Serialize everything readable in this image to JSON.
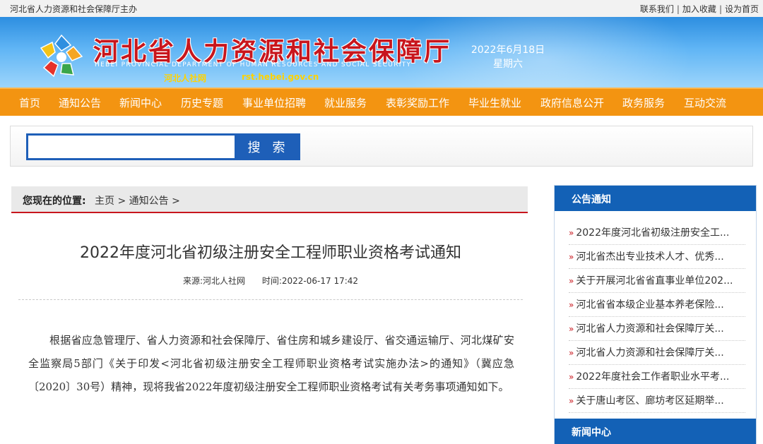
{
  "topbar": {
    "sponsor": "河北省人力资源和社会保障厅主办",
    "links": [
      "联系我们",
      "加入收藏",
      "设为首页"
    ]
  },
  "header": {
    "title_cn": "河北省人力资源和社会保障厅",
    "title_en": "HEBEI PROVINCIAL DEPARTMENT OF HUMAN RESOURCES AND SOCIAL SECURITY",
    "site_short": "河北人社网",
    "site_url": "rst.hebei.gov.cn",
    "date": "2022年6月18日",
    "weekday": "星期六"
  },
  "nav": {
    "items": [
      "首页",
      "通知公告",
      "新闻中心",
      "历史专题",
      "事业单位招聘",
      "就业服务",
      "表彰奖励工作",
      "毕业生就业",
      "政府信息公开",
      "政务服务",
      "互动交流"
    ]
  },
  "search": {
    "value": "",
    "button_label": "搜 索"
  },
  "breadcrumb": {
    "label": "您现在的位置:",
    "items": [
      "主页",
      "通知公告"
    ],
    "sep": ">"
  },
  "article": {
    "title": "2022年度河北省初级注册安全工程师职业资格考试通知",
    "source": "来源:河北人社网",
    "time": "时间:2022-06-17 17:42",
    "body": "根据省应急管理厅、省人力资源和社会保障厅、省住房和城乡建设厅、省交通运输厅、河北煤矿安全监察局5部门《关于印发<河北省初级注册安全工程师职业资格考试实施办法>的通知》（冀应急〔2020〕30号）精神，现将我省2022年度初级注册安全工程师职业资格考试有关考务事项通知如下。"
  },
  "sidebar": {
    "notice_title": "公告通知",
    "marker": "»",
    "items": [
      "2022年度河北省初级注册安全工...",
      "河北省杰出专业技术人才、优秀...",
      "关于开展河北省省直事业单位202...",
      "河北省省本级企业基本养老保险...",
      "河北省人力资源和社会保障厅关...",
      "河北省人力资源和社会保障厅关...",
      "2022年度社会工作者职业水平考...",
      "关于唐山考区、廊坊考区延期举..."
    ],
    "news_title": "新闻中心"
  },
  "colors": {
    "nav_orange": "#f39411",
    "brand_red": "#c8161d",
    "brand_blue": "#1361b6"
  }
}
